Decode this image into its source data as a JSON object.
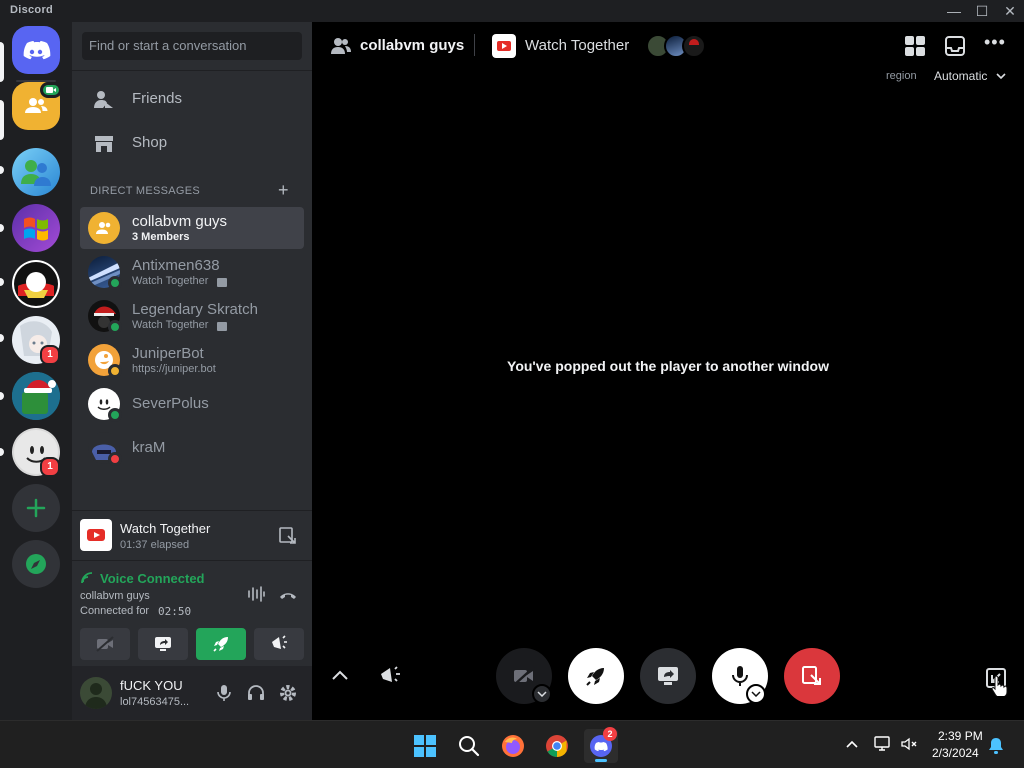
{
  "window": {
    "brand": "Discord",
    "minimize": "—",
    "maximize": "☐",
    "close": "✕"
  },
  "servers": {
    "badges": [
      "1",
      "1"
    ]
  },
  "sidebar": {
    "search_placeholder": "Find or start a conversation",
    "nav": [
      {
        "label": "Friends"
      },
      {
        "label": "Shop"
      }
    ],
    "dm_header": "DIRECT MESSAGES",
    "dm_add": "+",
    "dms": [
      {
        "name": "collabvm guys",
        "sub": "3 Members"
      },
      {
        "name": "Antixmen638",
        "sub": "Watch Together"
      },
      {
        "name": "Legendary Skratch",
        "sub": "Watch Together"
      },
      {
        "name": "JuniperBot",
        "sub": "https://juniper.bot"
      },
      {
        "name": "SeverPolus"
      },
      {
        "name": "kraM"
      }
    ],
    "activity": {
      "title": "Watch Together",
      "elapsed": "01:37 elapsed"
    },
    "voice": {
      "status": "Voice Connected",
      "channel": "collabvm guys",
      "connected_label": "Connected for",
      "connected_time": "02:50"
    },
    "user": {
      "name": "fUCK YOU",
      "tag": "lol74563475..."
    }
  },
  "header": {
    "channel": "collabvm guys",
    "activity": "Watch Together",
    "region_label": "region",
    "region_value": "Automatic"
  },
  "stage": {
    "message": "You've popped out the player to another window"
  },
  "taskbar": {
    "time": "2:39 PM",
    "date": "2/3/2024",
    "discord_badge": "2"
  },
  "colors": {
    "accent": "#5865f2",
    "green": "#23a55a",
    "red": "#da373c",
    "bg": "#000000"
  }
}
